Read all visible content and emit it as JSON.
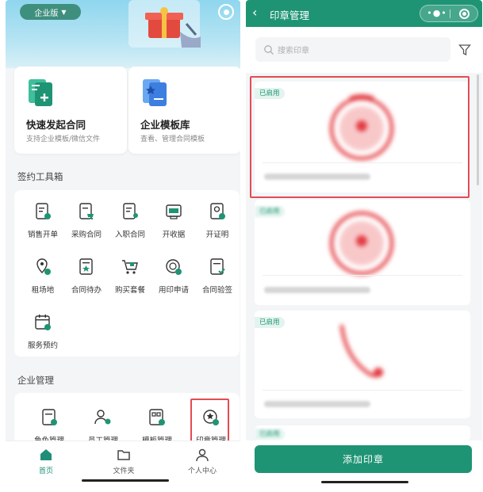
{
  "left": {
    "edition_label": "企业版",
    "cards": [
      {
        "title": "快速发起合同",
        "subtitle": "支持企业模板/微信文件"
      },
      {
        "title": "企业模板库",
        "subtitle": "查看、管理合同模板"
      }
    ],
    "toolbox_title": "签约工具箱",
    "tools": [
      {
        "label": "销售开单",
        "icon": "sales-order-icon"
      },
      {
        "label": "采购合同",
        "icon": "purchase-contract-icon"
      },
      {
        "label": "入职合同",
        "icon": "onboarding-contract-icon"
      },
      {
        "label": "开收据",
        "icon": "receipt-icon"
      },
      {
        "label": "开证明",
        "icon": "certificate-icon"
      },
      {
        "label": "租场地",
        "icon": "venue-rental-icon"
      },
      {
        "label": "合同待办",
        "icon": "contract-todo-icon"
      },
      {
        "label": "购买套餐",
        "icon": "cart-icon"
      },
      {
        "label": "用印申请",
        "icon": "seal-request-icon"
      },
      {
        "label": "合同验签",
        "icon": "contract-verify-icon"
      },
      {
        "label": "服务预约",
        "icon": "calendar-icon"
      }
    ],
    "management_title": "企业管理",
    "management": [
      {
        "label": "角色管理",
        "icon": "role-icon"
      },
      {
        "label": "员工管理",
        "icon": "staff-icon"
      },
      {
        "label": "模板管理",
        "icon": "template-icon"
      },
      {
        "label": "印章管理",
        "icon": "seal-manage-icon"
      }
    ],
    "tabbar": [
      {
        "label": "首页",
        "icon": "home-icon",
        "active": true
      },
      {
        "label": "文件夹",
        "icon": "folder-icon",
        "active": false
      },
      {
        "label": "个人中心",
        "icon": "person-icon",
        "active": false
      }
    ]
  },
  "right": {
    "title": "印章管理",
    "search_placeholder": "搜索印章",
    "seals": [
      {
        "status": "已启用"
      },
      {
        "status": "已启用"
      },
      {
        "status": "已启用"
      },
      {
        "status": "已启用"
      }
    ],
    "add_button": "添加印章"
  },
  "colors": {
    "brand_green": "#1f9475",
    "highlight_red": "#e44b53",
    "seal_red": "#e8585d"
  }
}
